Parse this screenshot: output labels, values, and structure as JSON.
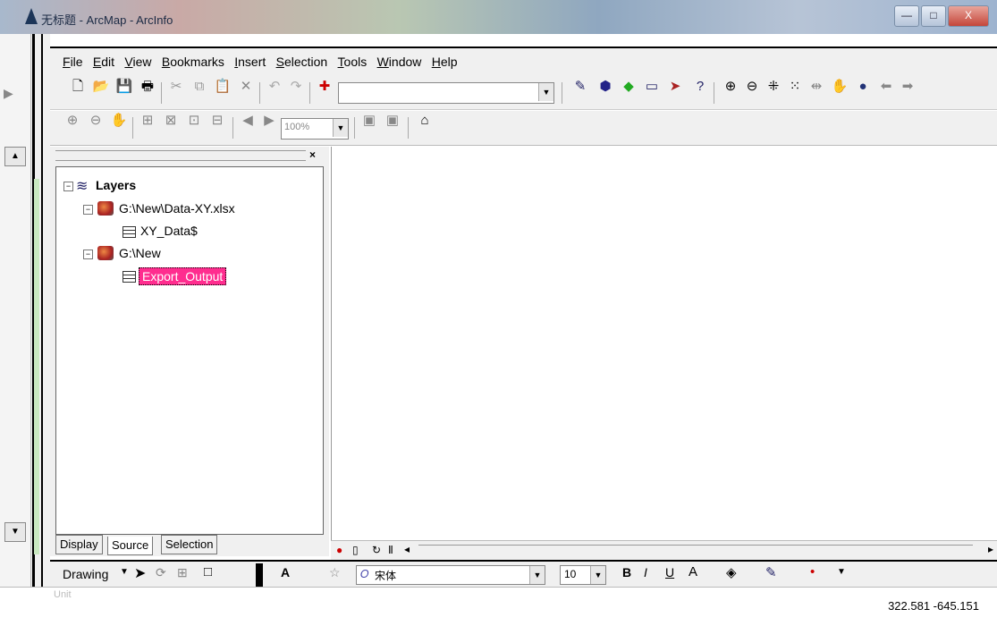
{
  "window": {
    "title": "无标题 - ArcMap - ArcInfo",
    "min": "—",
    "max": "□",
    "close": "X"
  },
  "menu": [
    "File",
    "Edit",
    "View",
    "Bookmarks",
    "Insert",
    "Selection",
    "Tools",
    "Window",
    "Help"
  ],
  "menu_underline": [
    "F",
    "E",
    "V",
    "B",
    "I",
    "S",
    "T",
    "W",
    "H"
  ],
  "toolbar_zoom_value": "100%",
  "toc": {
    "root": "Layers",
    "items": [
      {
        "label": "G:\\New\\Data-XY.xlsx",
        "type": "workspace"
      },
      {
        "label": "XY_Data$",
        "type": "table"
      },
      {
        "label": "G:\\New",
        "type": "workspace"
      },
      {
        "label": "Export_Output",
        "type": "table",
        "selected": true
      }
    ],
    "tabs": [
      "Display",
      "Source",
      "Selection"
    ],
    "active_tab": "Source"
  },
  "drawing": {
    "label": "Drawing",
    "font": "宋体",
    "size": "10",
    "bold": "B",
    "italic": "I",
    "underline": "U",
    "font_color": "A"
  },
  "status": {
    "coords": "322.581 -645.151",
    "units": "Unit"
  },
  "colors": {
    "selection_bg": "#ff2d8f",
    "panel": "#f0f0f0"
  }
}
